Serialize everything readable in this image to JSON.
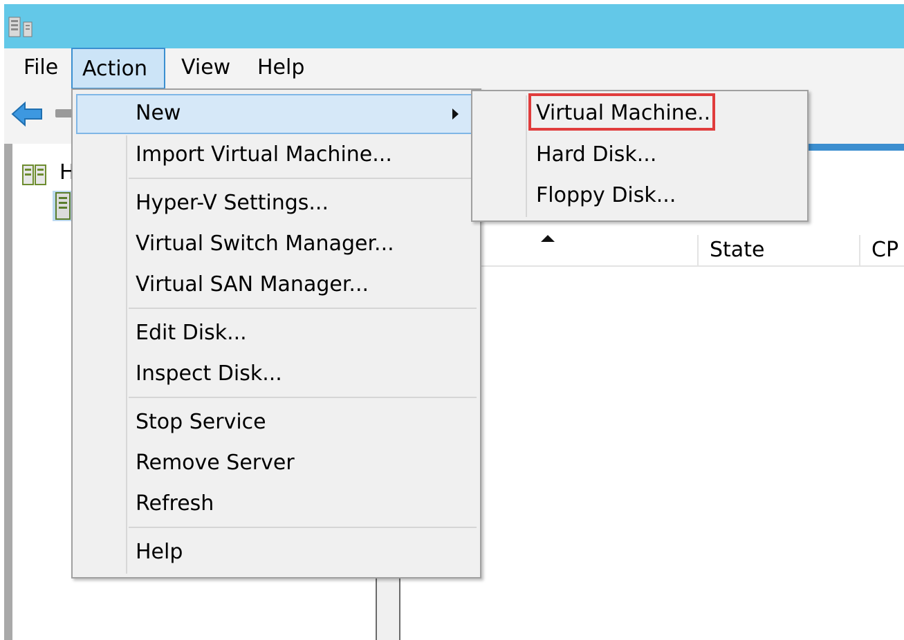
{
  "menubar": {
    "items": [
      "File",
      "Action",
      "View",
      "Help"
    ],
    "active": "Action"
  },
  "tree": {
    "root_label": "H"
  },
  "list": {
    "columns": [
      "State",
      "CP"
    ]
  },
  "action_menu": {
    "items": [
      "New",
      "Import Virtual Machine...",
      "Hyper-V Settings...",
      "Virtual Switch Manager...",
      "Virtual SAN Manager...",
      "Edit Disk...",
      "Inspect Disk...",
      "Stop Service",
      "Remove Server",
      "Refresh",
      "Help"
    ]
  },
  "new_submenu": {
    "items": [
      "Virtual Machine...",
      "Hard Disk...",
      "Floppy Disk..."
    ],
    "highlighted": "Virtual Machine..."
  },
  "colors": {
    "titlebar": "#63c8e8",
    "menu_highlight": "#d6e8f8",
    "callout_red": "#e03c3c"
  },
  "icons": {
    "app": "hyper-v-server-icon",
    "back": "back-arrow-icon",
    "tree_root": "hyper-v-manager-icon",
    "tree_child": "server-icon",
    "submenu": "submenu-arrow-icon",
    "sort": "sort-ascending-icon"
  }
}
